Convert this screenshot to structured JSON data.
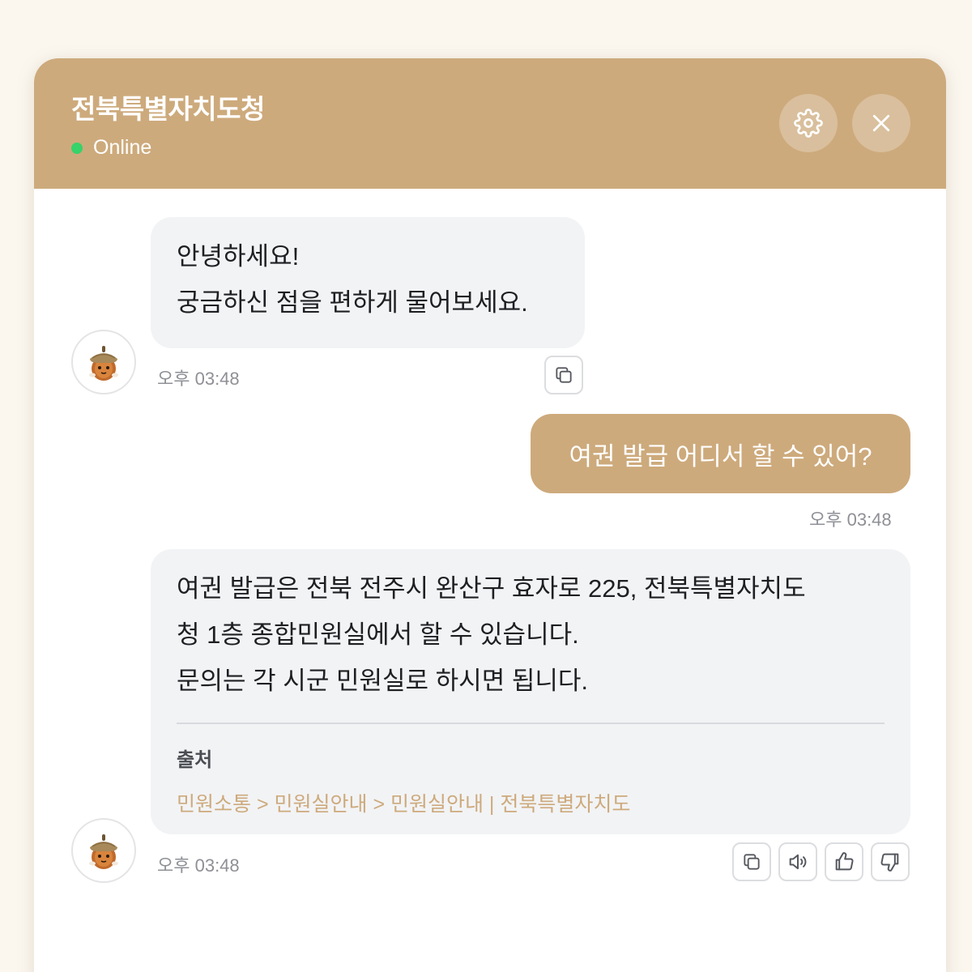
{
  "header": {
    "title": "전북특별자치도청",
    "status": "Online",
    "status_color": "#36d26a",
    "accent_color": "#cdaa7c",
    "settings_icon": "gear-icon",
    "close_icon": "close-icon"
  },
  "messages": [
    {
      "sender": "bot",
      "lines": [
        "안녕하세요!",
        "궁금하신 점을 편하게 물어보세요."
      ],
      "time": "오후 03:48",
      "actions": [
        "copy-icon"
      ]
    },
    {
      "sender": "user",
      "text": "여권 발급 어디서 할 수 있어?",
      "time": "오후 03:48"
    },
    {
      "sender": "bot",
      "lines": [
        "여권 발급은 전북 전주시 완산구 효자로 225, 전북특별자치도",
        "청 1층 종합민원실에서 할 수 있습니다.",
        "문의는 각 시군 민원실로 하시면 됩니다."
      ],
      "source_label": "출처",
      "source_link": "민원소통 > 민원실안내 > 민원실안내 | 전북특별자치도",
      "time": "오후 03:48",
      "actions": [
        "copy-icon",
        "speaker-icon",
        "thumbs-up-icon",
        "thumbs-down-icon"
      ]
    }
  ],
  "avatar_icon": "acorn-mascot-icon"
}
